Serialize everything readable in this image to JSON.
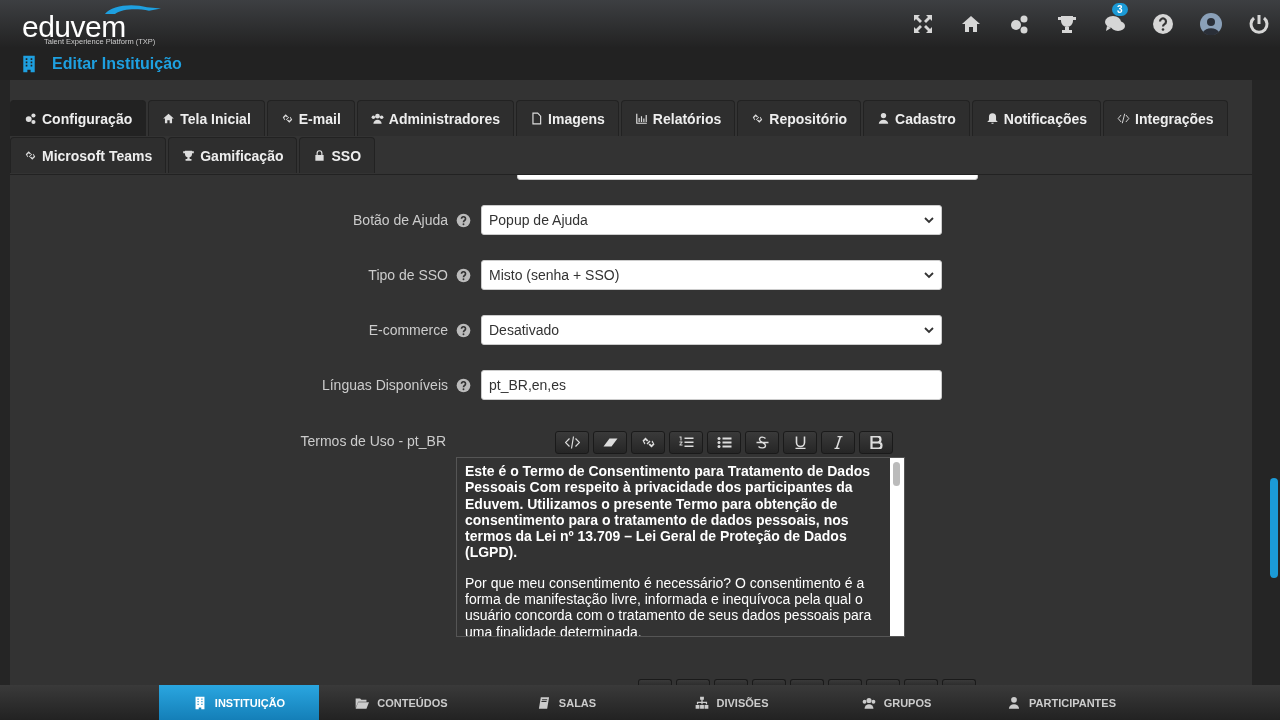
{
  "header": {
    "logo": "eduvem",
    "tagline": "Talent Experience Platform (TXP)",
    "notification_count": "3"
  },
  "page_title": "Editar Instituição",
  "tabs": [
    {
      "label": "Configuração",
      "selected": true
    },
    {
      "label": "Tela Inicial",
      "selected": false
    },
    {
      "label": "E-mail",
      "selected": false
    },
    {
      "label": "Administradores",
      "selected": false
    },
    {
      "label": "Imagens",
      "selected": false
    },
    {
      "label": "Relatórios",
      "selected": false
    },
    {
      "label": "Repositório",
      "selected": false
    },
    {
      "label": "Cadastro",
      "selected": false
    },
    {
      "label": "Notificações",
      "selected": false
    },
    {
      "label": "Integrações",
      "selected": false
    },
    {
      "label": "Microsoft Teams",
      "selected": false
    },
    {
      "label": "Gamificação",
      "selected": false
    },
    {
      "label": "SSO",
      "selected": false
    }
  ],
  "form": [
    {
      "kind": "cut"
    },
    {
      "kind": "select",
      "label": "Botão de Ajuda",
      "help": true,
      "value": "Popup de Ajuda"
    },
    {
      "kind": "select",
      "label": "Tipo de SSO",
      "help": true,
      "value": "Misto (senha + SSO)"
    },
    {
      "kind": "select",
      "label": "E-commerce",
      "help": true,
      "value": "Desativado"
    },
    {
      "kind": "text",
      "label": "Línguas Disponíveis",
      "help": true,
      "value": "pt_BR,en,es"
    },
    {
      "kind": "editor",
      "label": "Termos de Uso - pt_BR",
      "paragraphs": [
        {
          "bold": true,
          "text": "Este é o Termo de Consentimento para Tratamento de Dados Pessoais Com respeito à privacidade dos participantes da Eduvem. Utilizamos o presente Termo para obtenção de consentimento para o tratamento de dados pessoais, nos termos da Lei nº 13.709 – Lei Geral de Proteção de Dados (LGPD)."
        },
        {
          "bold": false,
          "text": "Por que meu consentimento é necessário? O consentimento é a forma de manifestação livre, informada e inequívoca pela qual o usuário concorda com o tratamento de seus dados pessoais para uma finalidade determinada."
        }
      ]
    },
    {
      "kind": "cut_toolbar"
    }
  ],
  "bottom_nav": [
    {
      "label": "INSTITUIÇÃO",
      "selected": true
    },
    {
      "label": "CONTEÚDOS",
      "selected": false
    },
    {
      "label": "SALAS",
      "selected": false
    },
    {
      "label": "DIVISÕES",
      "selected": false
    },
    {
      "label": "GRUPOS",
      "selected": false
    },
    {
      "label": "PARTICIPANTES",
      "selected": false
    }
  ]
}
